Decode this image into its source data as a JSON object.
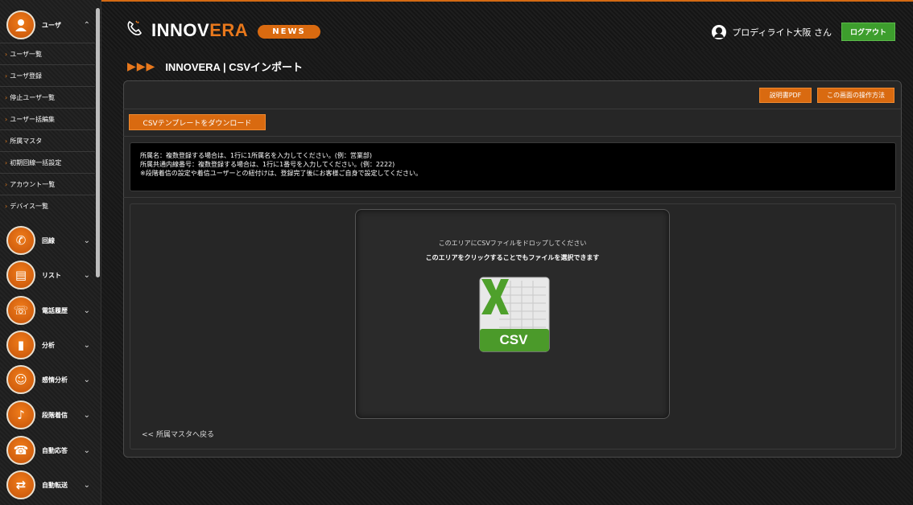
{
  "sidebar": {
    "user_menu": {
      "icon": "user-icon",
      "label": "ユーザ"
    },
    "sub_items": [
      "ユーザ一覧",
      "ユーザ登録",
      "停止ユーザ一覧",
      "ユーザー括編集",
      "所属マスタ",
      "初期回線一括設定",
      "アカウント一覧",
      "デバイス一覧"
    ],
    "menus": [
      {
        "icon": "line-icon",
        "label": "回線"
      },
      {
        "icon": "list-icon",
        "label": "リスト"
      },
      {
        "icon": "call-history-icon",
        "label": "電話履歴"
      },
      {
        "icon": "analysis-icon",
        "label": "分析"
      },
      {
        "icon": "emotion-analysis-icon",
        "label": "感情分析"
      },
      {
        "icon": "staged-ring-icon",
        "label": "段階着信"
      },
      {
        "icon": "auto-response-icon",
        "label": "自動応答"
      },
      {
        "icon": "auto-forward-icon",
        "label": "自動転送"
      }
    ]
  },
  "header": {
    "brand_main": "INNOV",
    "brand_accent": "ERA",
    "news_label": "NEWS",
    "user_name": "プロディライト大阪 さん",
    "logout_label": "ログアウト"
  },
  "page": {
    "title": "INNOVERA | CSVインポート",
    "manual_pdf_label": "説明書PDF",
    "howto_label": "この画面の操作方法",
    "template_download_label": "CSVテンプレートをダウンロード",
    "info_lines": [
      "所属名：複数登録する場合は、1行に1所属名を入力してください。(例：営業部)",
      "所属共通内線番号：複数登録する場合は、1行に1番号を入力してください。(例：2222)",
      "※段階着信の設定や着信ユーザーとの紐付けは、登録完了後にお客様ご自身で設定してください。"
    ],
    "drop_hint": "このエリアにCSVファイルをドロップしてください",
    "click_hint": "このエリアをクリックすることでもファイルを選択できます",
    "csv_icon_label": "CSV",
    "back_link": "<< 所属マスタへ戻る"
  },
  "colors": {
    "accent": "#d96a10",
    "logout": "#3d9e2d"
  }
}
